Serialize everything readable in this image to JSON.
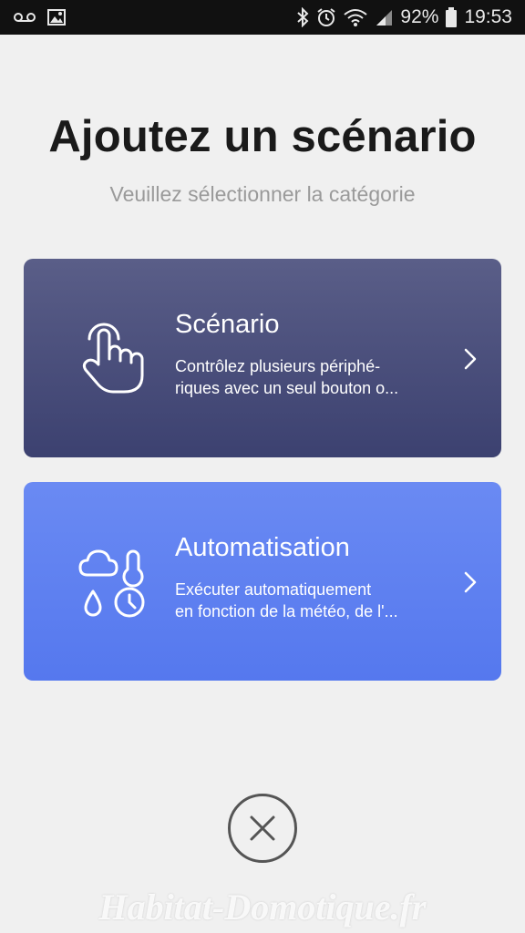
{
  "status_bar": {
    "battery": "92%",
    "time": "19:53",
    "icons": [
      "voicemail-icon",
      "image-icon",
      "bluetooth-icon",
      "alarm-icon",
      "wifi-icon",
      "signal-icon",
      "battery-icon"
    ]
  },
  "page": {
    "title": "Ajoutez un scénario",
    "subtitle": "Veuillez sélectionner la catégorie"
  },
  "categories": [
    {
      "title": "Scénario",
      "description": "Contrôlez plusieurs périphé-riques avec un seul bouton o...",
      "line1": "Contrôlez plusieurs périphé-",
      "line2": "riques avec un seul bouton o...",
      "icon": "hand-tap-icon",
      "color": "#4a4f7c"
    },
    {
      "title": "Automatisation",
      "line1": "Exécuter automatiquement",
      "line2": "en fonction de la météo, de l'...",
      "icon": "weather-conditions-icon",
      "color": "#5f82f1"
    }
  ],
  "close": {
    "icon": "close-icon"
  },
  "watermark": "Habitat-Domotique.fr"
}
